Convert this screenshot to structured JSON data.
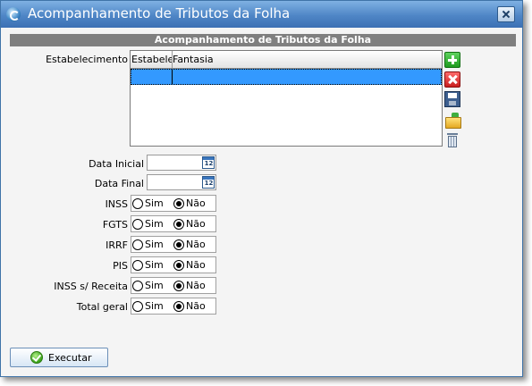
{
  "window": {
    "title": "Acompanhamento de Tributos da Folha"
  },
  "section": {
    "header": "Acompanhamento de Tributos da Folha"
  },
  "estabelecimento": {
    "label": "Estabelecimento",
    "columns": [
      "Estabelecimento",
      "Fantasia"
    ],
    "rows": [
      [
        "",
        ""
      ]
    ]
  },
  "dates": {
    "initial_label": "Data Inicial",
    "final_label": "Data Final",
    "initial_value": "",
    "final_value": "",
    "calendar_text": "12"
  },
  "options": {
    "sim_label": "Sim",
    "nao_label": "Não",
    "items": [
      {
        "label": "INSS",
        "selected": "Não"
      },
      {
        "label": "FGTS",
        "selected": "Não"
      },
      {
        "label": "IRRF",
        "selected": "Não"
      },
      {
        "label": "PIS",
        "selected": "Não"
      },
      {
        "label": "INSS s/ Receita",
        "selected": "Não"
      },
      {
        "label": "Total geral",
        "selected": "Não"
      }
    ]
  },
  "actions": {
    "run_label": "Executar"
  }
}
